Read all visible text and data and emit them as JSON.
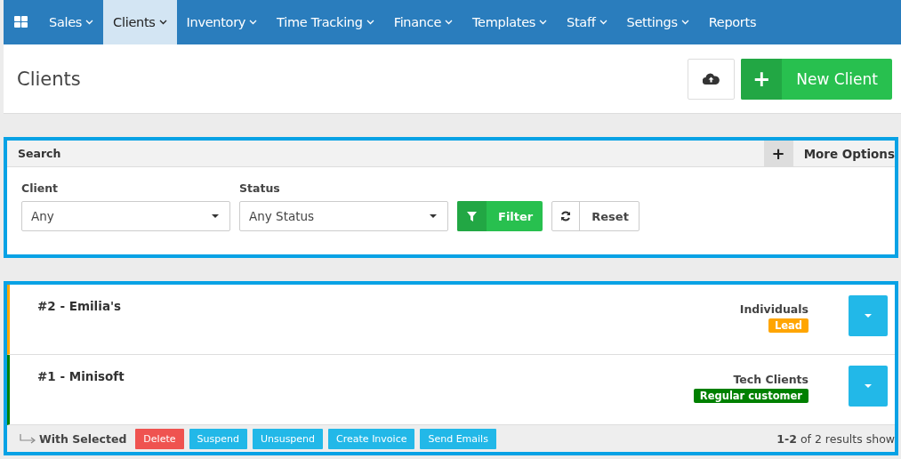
{
  "nav": {
    "items": [
      {
        "label": "Sales",
        "dropdown": true,
        "selected": false
      },
      {
        "label": "Clients",
        "dropdown": true,
        "selected": true
      },
      {
        "label": "Inventory",
        "dropdown": true,
        "selected": false
      },
      {
        "label": "Time Tracking",
        "dropdown": true,
        "selected": false
      },
      {
        "label": "Finance",
        "dropdown": true,
        "selected": false
      },
      {
        "label": "Templates",
        "dropdown": true,
        "selected": false
      },
      {
        "label": "Staff",
        "dropdown": true,
        "selected": false
      },
      {
        "label": "Settings",
        "dropdown": true,
        "selected": false
      },
      {
        "label": "Reports",
        "dropdown": false,
        "selected": false
      }
    ]
  },
  "page_title": "Clients",
  "new_button": {
    "icon": "+",
    "label": "New Client"
  },
  "search": {
    "title": "Search",
    "more_icon": "+",
    "more_label": "More Options",
    "fields": [
      {
        "label": "Client",
        "value": "Any"
      },
      {
        "label": "Status",
        "value": "Any Status"
      }
    ],
    "filter_button": "Filter",
    "reset_button": "Reset"
  },
  "clients": [
    {
      "name": "#2 - Emilia's",
      "group": "Individuals",
      "tag": "Lead",
      "color": "#ffa500"
    },
    {
      "name": "#1 - Minisoft",
      "group": "Tech Clients",
      "tag": "Regular customer",
      "color": "#008000"
    }
  ],
  "bulk": {
    "label": "With Selected",
    "actions": [
      {
        "label": "Delete",
        "kind": "danger"
      },
      {
        "label": "Suspend",
        "kind": "info"
      },
      {
        "label": "Unsuspend",
        "kind": "info"
      },
      {
        "label": "Create Invoice",
        "kind": "info"
      },
      {
        "label": "Send Emails",
        "kind": "info"
      }
    ],
    "results": "**1-2** of 2 results show"
  }
}
